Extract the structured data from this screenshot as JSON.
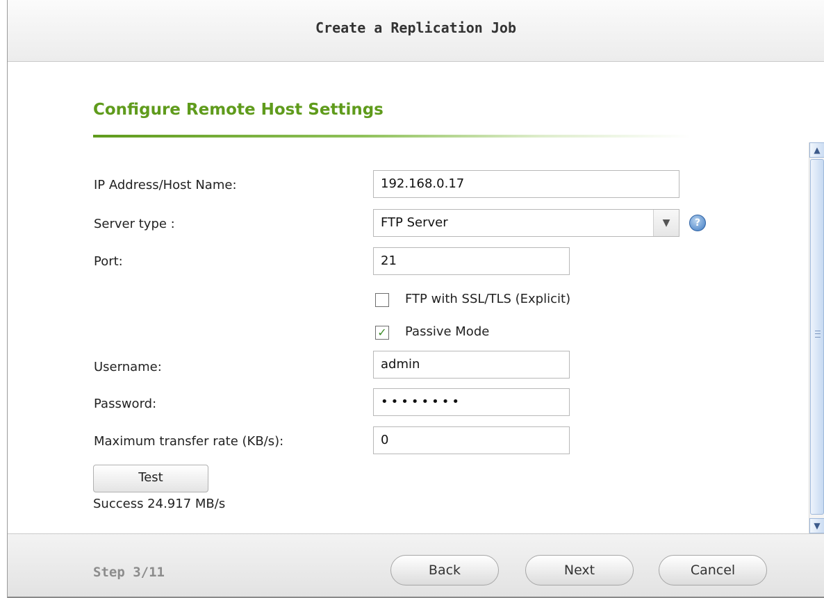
{
  "dialog": {
    "title": "Create a Replication Job",
    "section_title": "Configure Remote Host Settings"
  },
  "form": {
    "host_label": "IP Address/Host Name:",
    "host_value": "192.168.0.17",
    "server_type_label": "Server type :",
    "server_type_value": "FTP Server",
    "port_label": "Port:",
    "port_value": "21",
    "ftp_ssl_label": "FTP with SSL/TLS (Explicit)",
    "ftp_ssl_checked": false,
    "passive_mode_label": "Passive Mode",
    "passive_mode_checked": true,
    "username_label": "Username:",
    "username_value": "admin",
    "password_label": "Password:",
    "password_value": "••••••••",
    "max_rate_label": "Maximum transfer rate (KB/s):",
    "max_rate_value": "0",
    "test_button": "Test",
    "test_result": "Success 24.917 MB/s"
  },
  "footer": {
    "step": "Step 3/11",
    "back": "Back",
    "next": "Next",
    "cancel": "Cancel"
  },
  "icons": {
    "help": "help-icon",
    "dropdown": "chevron-down-icon",
    "check": "checkmark-icon",
    "scroll_up": "scroll-up-arrow-icon",
    "scroll_down": "scroll-down-arrow-icon"
  },
  "colors": {
    "accent_green": "#5f9b1c",
    "help_blue": "#3e7ac3"
  }
}
